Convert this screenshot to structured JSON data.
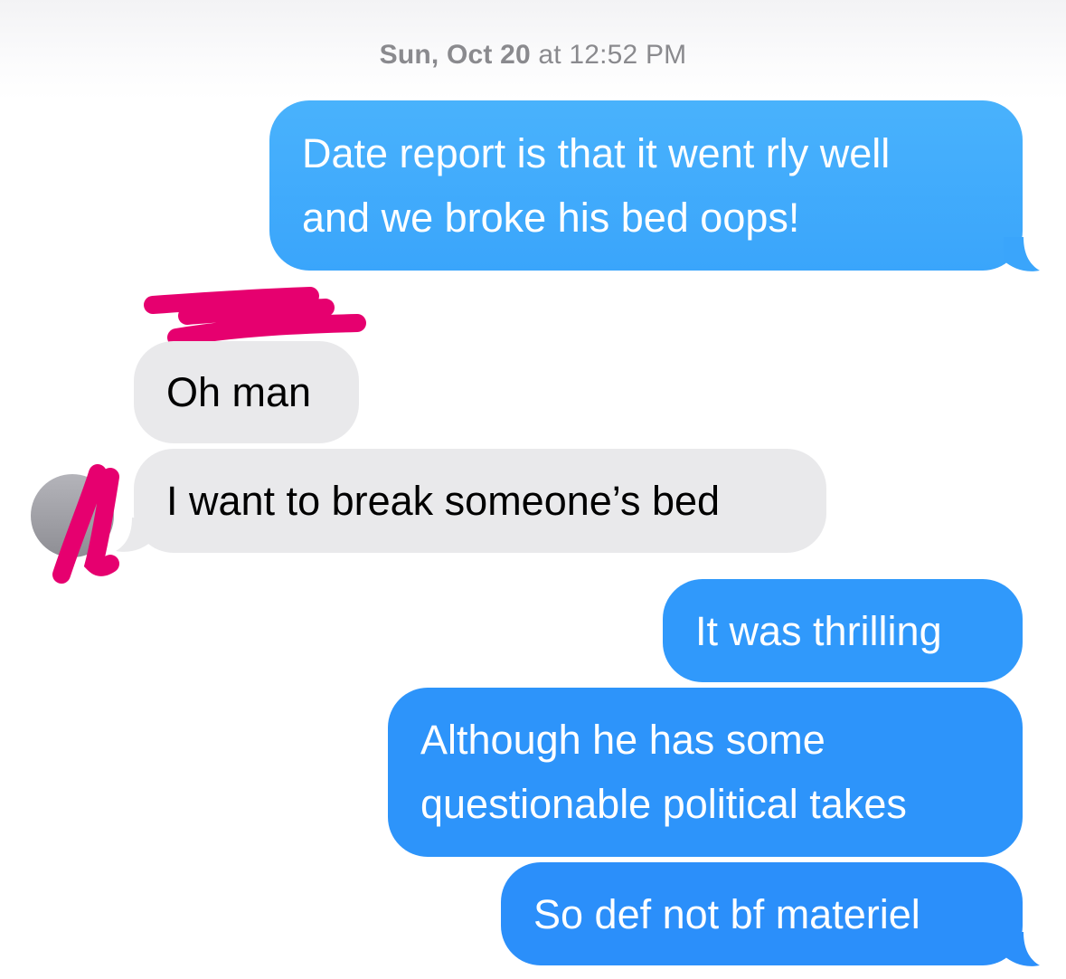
{
  "header": {
    "timestamp_day": "Sun, Oct 20",
    "timestamp_time": "at 12:52 PM"
  },
  "messages": [
    {
      "direction": "outgoing",
      "lines": [
        "Date report is that it went rly well",
        "and we broke his bed oops!"
      ]
    },
    {
      "direction": "incoming",
      "lines": [
        "Oh man"
      ]
    },
    {
      "direction": "incoming",
      "lines": [
        "I want to break someone’s bed"
      ]
    },
    {
      "direction": "outgoing",
      "lines": [
        "It was thrilling"
      ]
    },
    {
      "direction": "outgoing",
      "lines": [
        "Although he has some",
        "questionable political takes"
      ]
    },
    {
      "direction": "outgoing",
      "lines": [
        "So def not bf materiel"
      ]
    }
  ],
  "colors": {
    "outgoing_bubble": "#2b95fb",
    "incoming_bubble": "#e9e9eb",
    "redaction_scribble": "#e6006f",
    "timestamp_text": "#8a8a8e"
  },
  "icons": {
    "avatar": "contact-avatar-icon"
  }
}
